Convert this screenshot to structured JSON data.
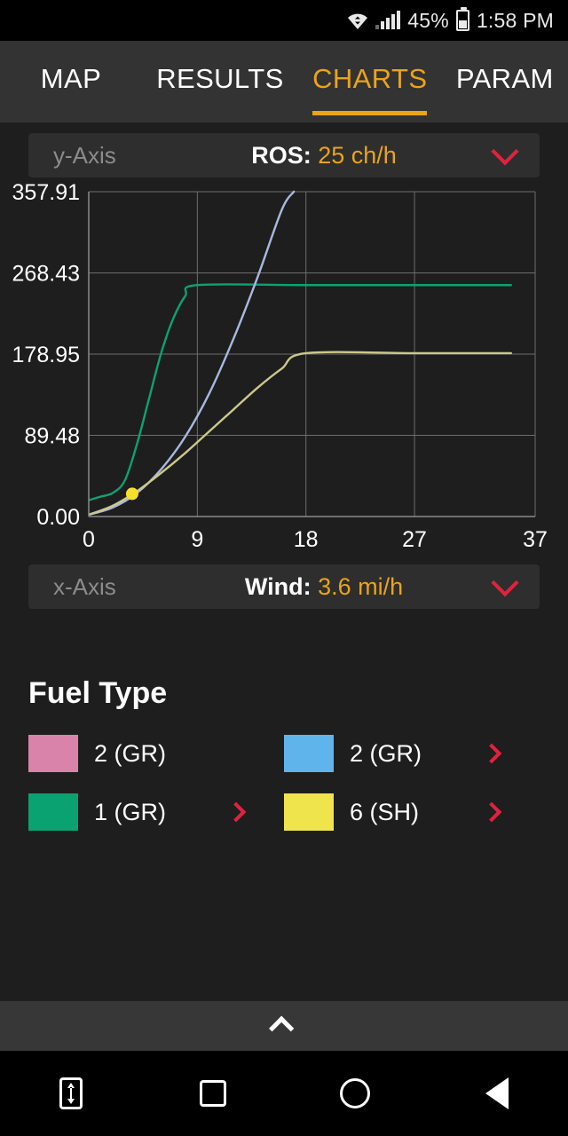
{
  "status_bar": {
    "wifi_icon": "wifi-icon",
    "signal_icon": "signal-bars-icon",
    "battery_percent": "45%",
    "battery_icon": "battery-icon",
    "time": "1:58 PM"
  },
  "tabs": [
    {
      "label": "MAP",
      "active": false
    },
    {
      "label": "RESULTS",
      "active": false
    },
    {
      "label": "CHARTS",
      "active": true
    },
    {
      "label": "PARAM",
      "active": false
    }
  ],
  "y_axis_selector": {
    "tag": "y-Axis",
    "key": "ROS:",
    "value": "25 ch/h",
    "chevron_icon": "chevron-down-icon"
  },
  "x_axis_selector": {
    "tag": "x-Axis",
    "key": "Wind:",
    "value": "3.6 mi/h",
    "chevron_icon": "chevron-down-icon"
  },
  "fuel_type": {
    "title": "Fuel Type",
    "items": [
      {
        "label": "2 (GR)",
        "color": "#d983ab",
        "chevron": false,
        "chevron_icon": "chevron-right-icon"
      },
      {
        "label": "2 (GR)",
        "color": "#5fb4ec",
        "chevron": true,
        "chevron_icon": "chevron-right-icon"
      },
      {
        "label": "1 (GR)",
        "color": "#0ba271",
        "chevron": true,
        "chevron_icon": "chevron-right-icon"
      },
      {
        "label": "6 (SH)",
        "color": "#f0e44c",
        "chevron": true,
        "chevron_icon": "chevron-right-icon"
      }
    ]
  },
  "sheet_handle": {
    "icon": "chevron-up-icon"
  },
  "nav_bar": {
    "buttons": [
      {
        "icon": "keyboard-resize-icon"
      },
      {
        "icon": "recents-square-icon"
      },
      {
        "icon": "home-circle-icon"
      },
      {
        "icon": "back-triangle-icon"
      }
    ]
  },
  "chart_data": {
    "type": "line",
    "title": "",
    "xlabel": "Wind (mi/h)",
    "ylabel": "ROS (ch/h)",
    "xlim": [
      0,
      37
    ],
    "ylim": [
      0,
      357.91
    ],
    "grid": true,
    "legend": "below-chart",
    "xticks": [
      "0",
      "9",
      "18",
      "27",
      "37"
    ],
    "xtick_values": [
      0,
      9,
      18,
      27,
      37
    ],
    "yticks": [
      "0.00",
      "89.48",
      "178.95",
      "268.43",
      "357.91"
    ],
    "ytick_values": [
      0,
      89.48,
      178.95,
      268.43,
      357.91
    ],
    "marker": {
      "x": 3.6,
      "y": 25,
      "color": "#f5e02a",
      "label": "25 ch/h"
    },
    "series": [
      {
        "name": "1 (GR)",
        "color": "#0ba271",
        "x": [
          0,
          1,
          2,
          3,
          4,
          5,
          6,
          7,
          8,
          9,
          18,
          27,
          35
        ],
        "y": [
          18,
          22,
          26,
          40,
          80,
          130,
          180,
          218,
          243,
          255,
          255,
          255,
          255
        ]
      },
      {
        "name": "2 (GR)",
        "color": "#aab8e0",
        "x": [
          0,
          2,
          4,
          6,
          8,
          10,
          12,
          14,
          16,
          17
        ],
        "y": [
          2,
          10,
          26,
          52,
          88,
          136,
          196,
          264,
          338,
          358
        ]
      },
      {
        "name": "6 (SH)",
        "color": "#ccc98a",
        "x": [
          0,
          2,
          4,
          6,
          8,
          10,
          12,
          14,
          16,
          18,
          27,
          35
        ],
        "y": [
          2,
          12,
          28,
          48,
          70,
          94,
          118,
          142,
          163,
          180,
          180,
          180
        ]
      }
    ]
  }
}
